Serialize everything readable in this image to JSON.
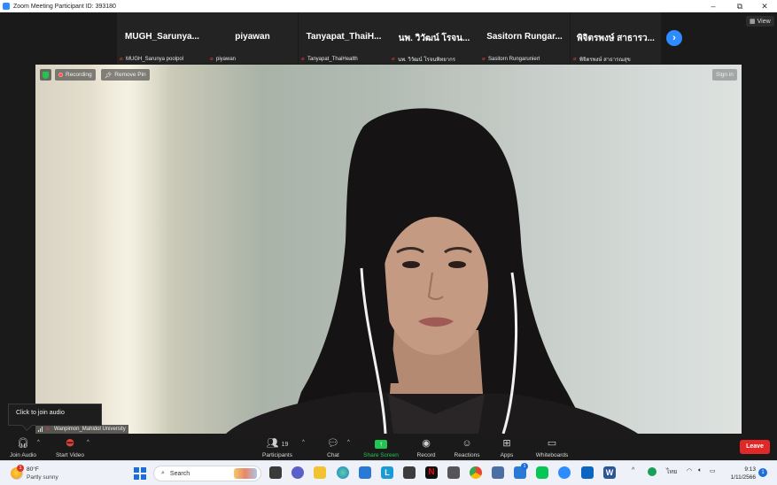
{
  "window": {
    "title": "Zoom Meeting Participant ID: 393180",
    "minimize": "–",
    "restore": "⧉",
    "close": "✕"
  },
  "strip": {
    "view_label": "View",
    "participants": [
      {
        "name": "MUGH_Sarunya...",
        "label": "MUGH_Sarunya poolpol"
      },
      {
        "name": "piyawan",
        "label": "piyawan"
      },
      {
        "name": "Tanyapat_ThaiH...",
        "label": "Tanyapat_ThaiHealth"
      },
      {
        "name": "นพ. วิวัฒน์ โรจน...",
        "label": "นพ. วิวัฒน์ โรจนพิทยากร"
      },
      {
        "name": "Sasitorn Rungar...",
        "label": "Sasitorn Rungaruniert"
      },
      {
        "name": "พิจิตรพงษ์ สาธารว...",
        "label": "พิจิตรพงษ์ สาธารณสุข"
      }
    ],
    "next_icon": "›"
  },
  "video": {
    "recording_label": "Recording",
    "remove_pin_label": "Remove Pin",
    "sign_in_label": "Sign in",
    "speaker_label": "Wanpimon_Mahidol University",
    "tooltip": "Click to join audio"
  },
  "toolbar": {
    "join_audio": "Join Audio",
    "start_video": "Start Video",
    "participants": "Participants",
    "participants_count": "19",
    "chat": "Chat",
    "share_screen": "Share Screen",
    "record": "Record",
    "reactions": "Reactions",
    "apps": "Apps",
    "whiteboards": "Whiteboards",
    "leave": "Leave",
    "caret": "^"
  },
  "taskbar": {
    "weather_temp": "80°F",
    "weather_cond": "Partly sunny",
    "weather_badge": "1",
    "search_label": "Search",
    "lang": "ไทย",
    "time": "9:13",
    "date": "1/11/2566",
    "notif_count": "1",
    "zoom_badge": "1",
    "chevron_up": "^"
  },
  "colors": {
    "zoom_blue": "#2d8cff",
    "leave_red": "#e02828",
    "share_green": "#23c552"
  }
}
